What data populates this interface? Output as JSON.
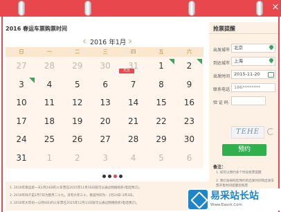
{
  "page": {
    "title": "2016 春运车票购票时间",
    "close_glyph": "×"
  },
  "calendar": {
    "prev_icon": "‹",
    "next_icon": "›",
    "month_label": "2016 年1月",
    "weekdays": [
      "日",
      "一",
      "二",
      "三",
      "四",
      "五",
      "六"
    ],
    "weeks": [
      [
        {
          "day": "27",
          "other": true
        },
        {
          "day": "28",
          "other": true
        },
        {
          "day": "29",
          "other": true
        },
        {
          "day": "30",
          "other": true
        },
        {
          "day": "31",
          "other": true
        },
        {
          "day": "1",
          "other": false,
          "flag": true
        },
        {
          "day": "2",
          "other": false,
          "flag": true
        }
      ],
      [
        {
          "day": "3",
          "other": false,
          "flag": true
        },
        {
          "day": "4",
          "other": false
        },
        {
          "day": "5",
          "other": false
        },
        {
          "day": "6",
          "other": false
        },
        {
          "day": "7",
          "other": false
        },
        {
          "day": "8",
          "other": false
        },
        {
          "day": "9",
          "other": false
        }
      ],
      [
        {
          "day": "10",
          "other": false
        },
        {
          "day": "11",
          "other": false
        },
        {
          "day": "12",
          "other": false
        },
        {
          "day": "13",
          "other": false
        },
        {
          "day": "14",
          "other": false
        },
        {
          "day": "15",
          "other": false
        },
        {
          "day": "16",
          "other": false
        }
      ],
      [
        {
          "day": "17",
          "other": false
        },
        {
          "day": "18",
          "other": false
        },
        {
          "day": "19",
          "other": false
        },
        {
          "day": "20",
          "other": false
        },
        {
          "day": "21",
          "other": false
        },
        {
          "day": "22",
          "other": false
        },
        {
          "day": "23",
          "other": false
        }
      ],
      [
        {
          "day": "24",
          "other": false
        },
        {
          "day": "25",
          "other": false
        },
        {
          "day": "26",
          "other": false
        },
        {
          "day": "27",
          "other": false
        },
        {
          "day": "28",
          "other": false
        },
        {
          "day": "29",
          "other": false
        },
        {
          "day": "30",
          "other": false
        }
      ],
      [
        {
          "day": "31",
          "other": false
        },
        {
          "day": "1",
          "other": true
        },
        {
          "day": "2",
          "other": true
        },
        {
          "day": "3",
          "other": true
        },
        {
          "day": "4",
          "other": true
        },
        {
          "day": "5",
          "other": true
        },
        {
          "day": "6",
          "other": true
        }
      ]
    ],
    "holiday_tag": "元旦",
    "pager_dots": 4,
    "pager_active": 2
  },
  "notes": [
    "1. 2016年春运第一天1月24日的火车票在2015年11月26日就可以通过网络购买(电话预订)。",
    "2. 2016年除夕是2月7日为腊月二十九，没有大年三十，春运时间为：1月24日-3月3日。",
    "3. 2016年大年初一(2月8日)的火车票在2015年12月11日就可以通过网络购买(电话预订)。"
  ],
  "booking": {
    "title": "抢票提醒",
    "from_label": "出发城市",
    "from_value": "北京",
    "to_label": "到达城市",
    "to_value": "上海",
    "date_label": "出发时间",
    "date_value": "2015-11-20",
    "phone_label": "联系电话",
    "phone_value": "186********",
    "captcha_label": "验 证 码",
    "captcha_text": "TEHE",
    "submit_label": "预约",
    "note_heading": "备注：",
    "note_items": [
      "1. 如可以预约多个时段抢票提醒",
      "2. 我们会按照您预约的出发时间和出发车票开售时间提醒您购票"
    ]
  },
  "brand": {
    "name": "易采站长站",
    "url": "Www.Easck.Com"
  },
  "colors": {
    "accent": "#e8474e",
    "green": "#2fb04d",
    "gold": "#d2b27a"
  }
}
